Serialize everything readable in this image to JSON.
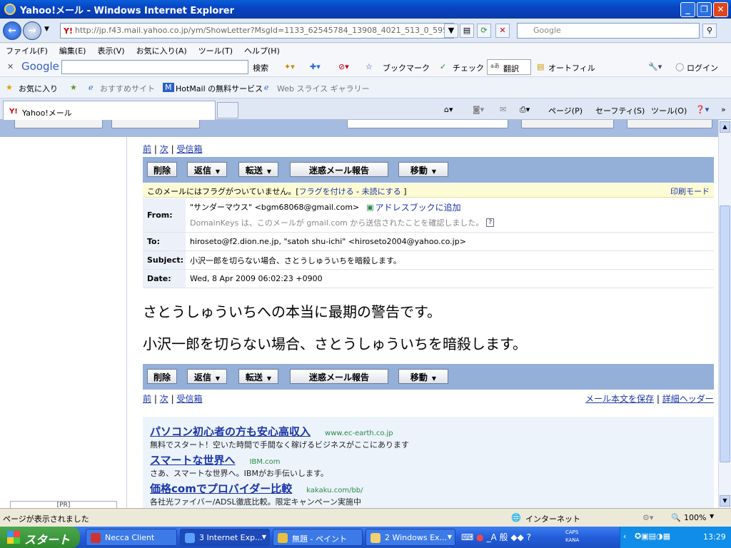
{
  "window": {
    "title": "Yahoo!メール - Windows Internet Explorer"
  },
  "address": {
    "url": "http://jp.f43.mail.yahoo.co.jp/ym/ShowLetter?MsgId=1133_62545784_13908_4021_513_0_595262_1044_",
    "search_placeholder": "Google"
  },
  "menu": [
    "ファイル(F)",
    "編集(E)",
    "表示(V)",
    "お気に入り(A)",
    "ツール(T)",
    "ヘルプ(H)"
  ],
  "google_bar": {
    "logo": "Google",
    "search": "検索",
    "bookmarks": "ブックマーク",
    "check": "チェック",
    "translate": "翻訳",
    "autofill": "オートフィル",
    "login": "ログイン"
  },
  "favorites": {
    "label": "お気に入り",
    "items": [
      "おすすめサイト",
      "HotMail の無料サービス",
      "Web スライス ギャラリー"
    ]
  },
  "tab": {
    "label": "Yahoo!メール"
  },
  "tab_tools": {
    "page": "ページ(P)",
    "safety": "セーフティ(S)",
    "tools": "ツール(O)"
  },
  "nav": {
    "prev": "前",
    "next": "次",
    "inbox": "受信箱",
    "sep": "|"
  },
  "actions": {
    "delete": "削除",
    "reply": "返信",
    "forward": "転送",
    "spam": "迷惑メール報告",
    "move": "移動"
  },
  "flag": {
    "text": "このメールにはフラグがついていません。[",
    "set": "フラグを付ける",
    "dash": " - ",
    "unread": "未読にする",
    "close": " ]",
    "print": "印刷モード"
  },
  "headers": {
    "from_label": "From:",
    "from_value": "\"サンダーマウス\" <bgm68068@gmail.com>",
    "addressbook": "アドレスブックに追加",
    "domainkeys": "DomainKeys は、このメールが gmail.com から送信されたことを確認しました。",
    "to_label": "To:",
    "to_value": "hiroseto@f2.dion.ne.jp, \"satoh shu-ichi\" <hiroseto2004@yahoo.co.jp>",
    "subject_label": "Subject:",
    "subject_value": "小沢一郎を切らない場合、さとうしゅういちを暗殺します。",
    "date_label": "Date:",
    "date_value": "Wed, 8 Apr 2009 06:02:23 +0900"
  },
  "body": {
    "line1": "さとうしゅういちへの本当に最期の警告です。",
    "line2": "小沢一郎を切らない場合、さとうしゅういちを暗殺します。"
  },
  "footer_links": {
    "save": "メール本文を保存",
    "headers": "詳細ヘッダー"
  },
  "ads": [
    {
      "title": "パソコン初心者の方も安心高収入",
      "url": "www.ec-earth.co.jp",
      "desc": "無料でスタート！空いた時間で手間なく稼げるビジネスがここにあります"
    },
    {
      "title": "スマートな世界へ",
      "url": "IBM.com",
      "desc": "さあ、スマートな世界へ。IBMがお手伝いします。"
    },
    {
      "title": "価格comでプロバイダー比較",
      "url": "kakaku.com/bb/",
      "desc": "各社光ファイバー/ADSL徹底比較。限定キャンペーン実施中"
    }
  ],
  "left_pane": {
    "pp_label": "[PR]"
  },
  "status": {
    "text": "ページが表示されました",
    "zone": "インターネット",
    "zoom": "100%"
  },
  "taskbar": {
    "start": "スタート",
    "tasks": [
      "Necca Client",
      "3 Internet Exp...",
      "無題 - ペイント",
      "2 Windows Ex..."
    ],
    "ime": "般",
    "caps": "CAPS",
    "kana": "KANA",
    "clock": "13:29"
  }
}
